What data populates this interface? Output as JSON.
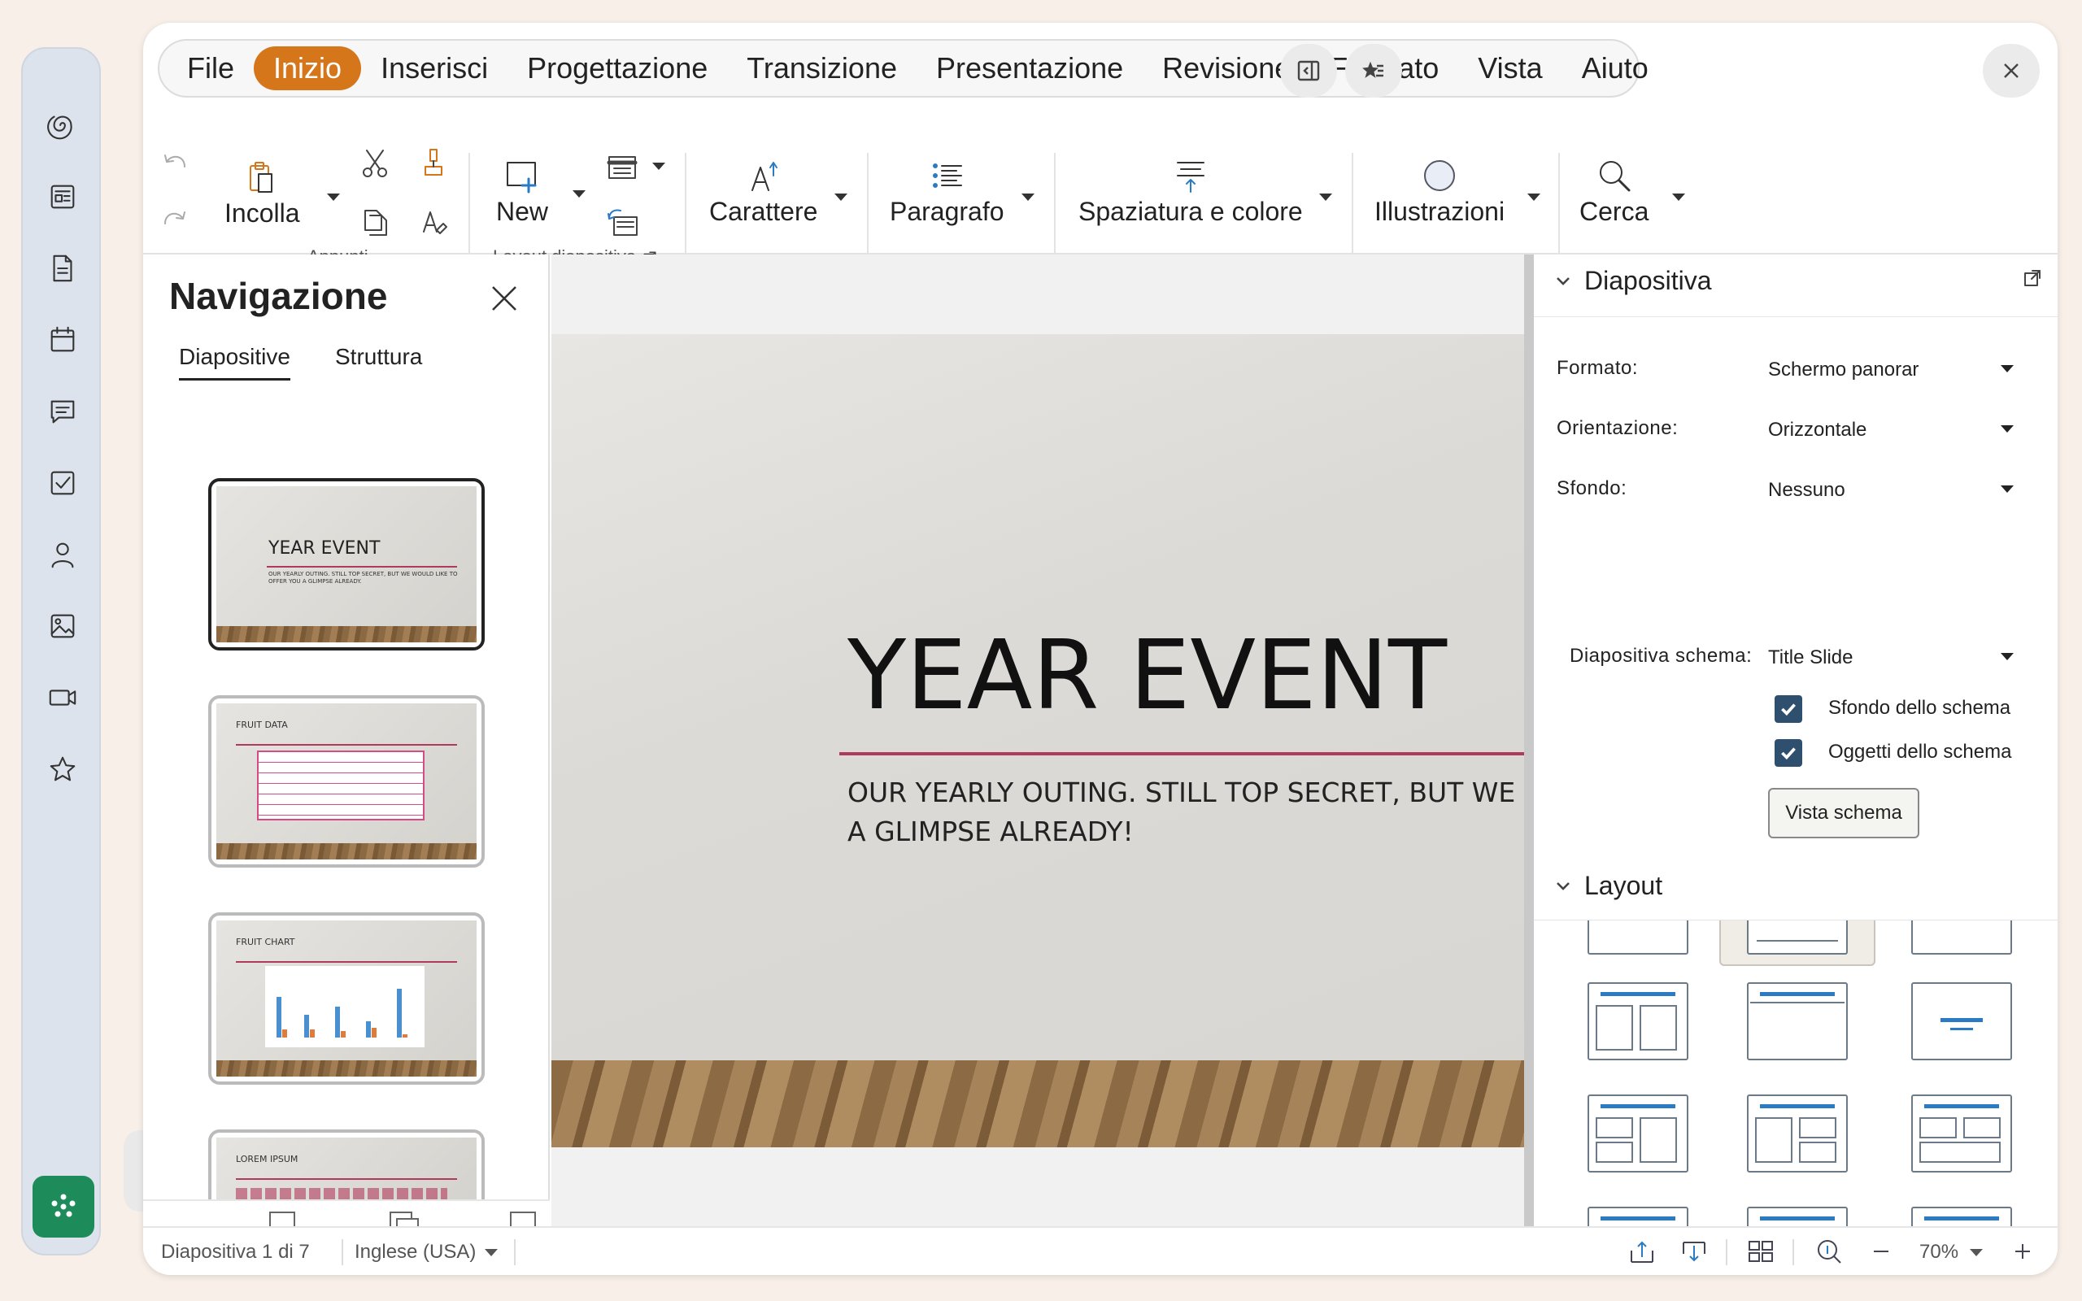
{
  "menubar": {
    "items": [
      "File",
      "Inizio",
      "Inserisci",
      "Progettazione",
      "Transizione",
      "Presentazione",
      "Revisione",
      "Formato",
      "Vista",
      "Aiuto"
    ],
    "active": "Inizio"
  },
  "ribbon": {
    "paste": "Incolla",
    "clipboard_group": "Appunti",
    "new_slide": "New",
    "layout_group": "Layout diapositiva",
    "character": "Carattere",
    "paragraph": "Paragrafo",
    "spacing": "Spaziatura e colore",
    "illustrations": "Illustrazioni",
    "search": "Cerca"
  },
  "navigator": {
    "title": "Navigazione",
    "tabs": [
      "Diapositive",
      "Struttura"
    ],
    "thumbs": [
      {
        "title": "YEAR EVENT",
        "subtitle": "OUR YEARLY OUTING. STILL TOP SECRET, BUT WE WOULD LIKE TO OFFER YOU A GLIMPSE ALREADY."
      },
      {
        "title": "FRUIT DATA"
      },
      {
        "title": "FRUIT CHART"
      },
      {
        "title": "LOREM IPSUM"
      }
    ]
  },
  "slide": {
    "title": "YEAR EVENT",
    "subtitle_line1": "OUR YEARLY OUTING. STILL TOP SECRET, BUT WE WOU",
    "subtitle_line2": "A GLIMPSE ALREADY!"
  },
  "sidebar": {
    "section_slide": "Diapositiva",
    "format_label": "Formato:",
    "format_value": "Schermo panorar",
    "orientation_label": "Orientazione:",
    "orientation_value": "Orizzontale",
    "background_label": "Sfondo:",
    "background_value": "Nessuno",
    "master_label": "Diapositiva schema:",
    "master_value": "Title Slide",
    "master_background": "Sfondo dello schema",
    "master_objects": "Oggetti dello schema",
    "master_view_button": "Vista schema",
    "section_layout": "Layout"
  },
  "status": {
    "slide_count": "Diapositiva 1 di 7",
    "language": "Inglese (USA)",
    "zoom": "70%"
  },
  "colors": {
    "accent": "#d5761a",
    "app_green": "#1e8c5a",
    "title_rule": "#b03a5a",
    "checkbox": "#2f4f6e",
    "layout_bar": "#2a7bc4"
  }
}
